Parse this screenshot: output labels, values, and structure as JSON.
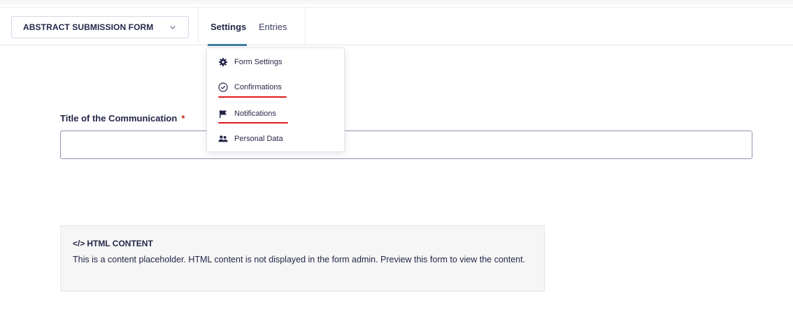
{
  "header": {
    "form_selector": {
      "value": "ABSTRACT SUBMISSION FORM",
      "icon": "chevron-down-icon"
    },
    "tabs": [
      {
        "label": "Settings",
        "active": true
      },
      {
        "label": "Entries",
        "active": false
      }
    ],
    "accent_color": "#3e7da6"
  },
  "settings_menu": {
    "items": [
      {
        "label": "Form Settings",
        "icon": "gear-icon"
      },
      {
        "label": "Confirmations",
        "icon": "check-circle-icon",
        "highlighted": true
      },
      {
        "label": "Notifications",
        "icon": "flag-icon",
        "highlighted": true
      },
      {
        "label": "Personal Data",
        "icon": "users-icon"
      }
    ],
    "highlight_color": "#e01e1e"
  },
  "form": {
    "field_label": "Title of the Communication",
    "required_marker": "*",
    "html_block": {
      "icon": "code-icon",
      "icon_text": "</>",
      "title": "HTML CONTENT",
      "description": "This is a content placeholder. HTML content is not displayed in the form admin. Preview this form to view the content."
    }
  }
}
